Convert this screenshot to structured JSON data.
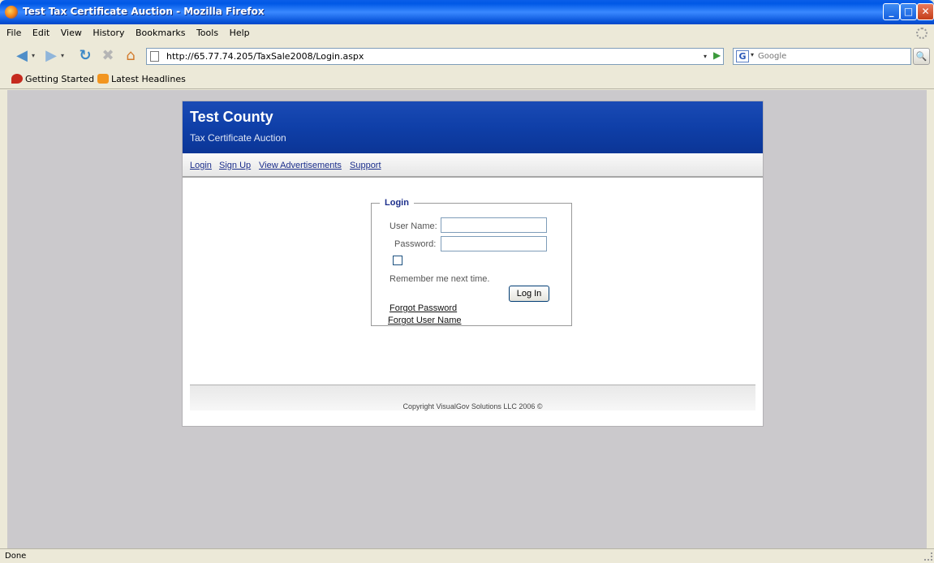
{
  "window": {
    "title": "Test Tax Certificate Auction - Mozilla Firefox",
    "min_glyph": "_",
    "max_glyph": "□",
    "close_glyph": "✕"
  },
  "menu": [
    "File",
    "Edit",
    "View",
    "History",
    "Bookmarks",
    "Tools",
    "Help"
  ],
  "navigation": {
    "back_glyph": "◀",
    "forward_glyph": "▶",
    "reload_glyph": "↻",
    "stop_glyph": "✖",
    "home_glyph": "⌂",
    "dropdown_glyph": "▾",
    "url": "http://65.77.74.205/TaxSale2008/Login.aspx",
    "go_glyph": "▶"
  },
  "search": {
    "engine_glyph": "G",
    "placeholder": "Google",
    "button_glyph": "🔍"
  },
  "bookmarks": [
    "Getting Started",
    "Latest Headlines"
  ],
  "page": {
    "county": "Test County",
    "subtitle": "Tax Certificate Auction",
    "nav": [
      "Login",
      "Sign Up",
      "View Advertisements",
      "Support"
    ],
    "login": {
      "legend": "Login",
      "username_label": "User Name:",
      "username_value": "",
      "password_label": "Password:",
      "password_value": "",
      "remember_checked": false,
      "remember_label": "Remember me next time.",
      "login_button": "Log In",
      "forgot_password": "Forgot Password",
      "forgot_username": "Forgot User Name"
    },
    "footer": "Copyright VisualGov Solutions LLC 2006 ©"
  },
  "status": "Done",
  "colors": {
    "header_blue": "#0f3fa8",
    "link_blue": "#1c2f8c",
    "viewport_gray": "#cbc9cc",
    "chrome": "#ece9d8"
  }
}
